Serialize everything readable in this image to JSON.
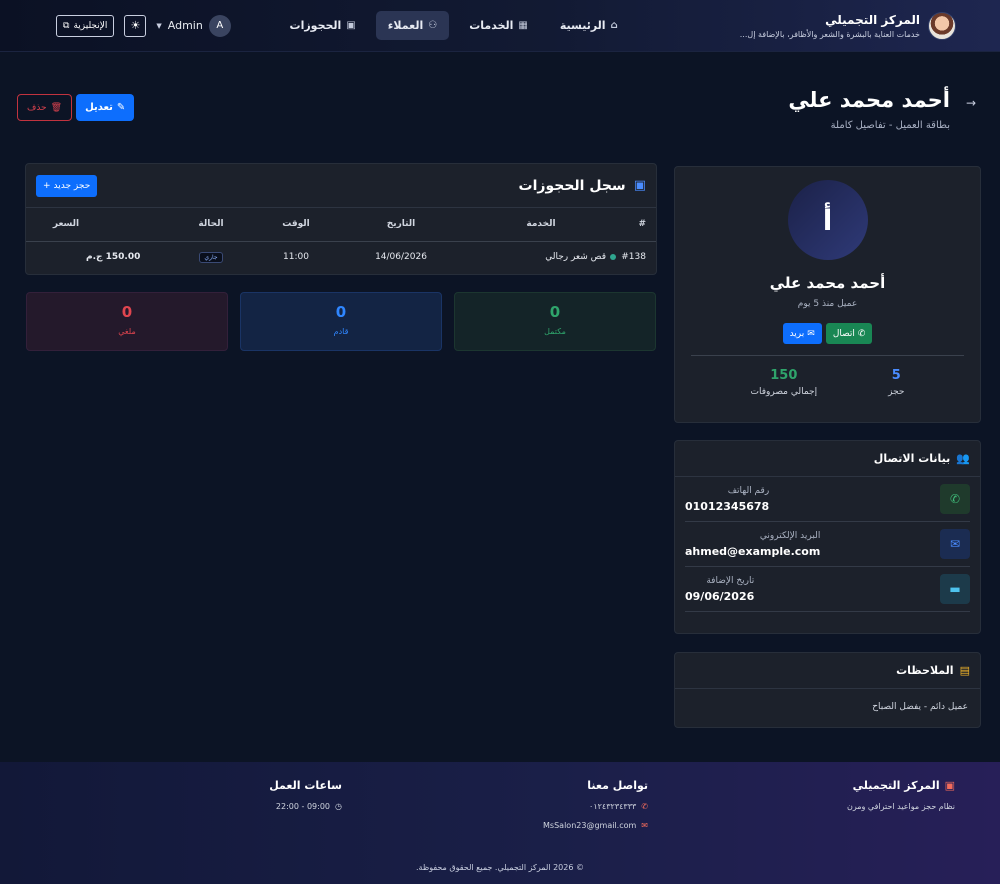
{
  "navbar": {
    "brand_name": "المركز التجميلي",
    "brand_tagline": "خدمات العناية بالبشرة والشعر والأظافر، بالإضافة إل...",
    "links": [
      {
        "label": "الرئيسية",
        "icon": "home-icon"
      },
      {
        "label": "الخدمات",
        "icon": "grid-icon"
      },
      {
        "label": "العملاء",
        "icon": "users-icon"
      },
      {
        "label": "الحجوزات",
        "icon": "calendar-icon"
      }
    ],
    "active_link": "العملاء",
    "user_name": "Admin",
    "user_initial": "A",
    "language_label": "الإنجليزية"
  },
  "header": {
    "title": "أحمد محمد علي",
    "subtitle": "بطاقة العميل - تفاصيل كاملة",
    "edit_label": "تعديل",
    "delete_label": "حذف"
  },
  "profile": {
    "initial": "أ",
    "name": "أحمد محمد علي",
    "since": "عميل منذ 5 يوم",
    "call_label": "اتصال",
    "mail_label": "بريد",
    "stats": [
      {
        "value": "5",
        "label": "حجز",
        "color": "#4a8cff"
      },
      {
        "value": "150",
        "label": "إجمالي مصروفات",
        "color": "#2fa46b"
      }
    ]
  },
  "contact": {
    "title": "بيانات الاتصال",
    "rows": [
      {
        "label": "رقم الهاتف",
        "value": "01012345678",
        "icon": "phone-icon"
      },
      {
        "label": "البريد الإلكتروني",
        "value": "ahmed@example.com",
        "icon": "envelope-icon"
      },
      {
        "label": "تاريخ الإضافة",
        "value": "09/06/2026",
        "icon": "calendar-icon"
      }
    ]
  },
  "notes": {
    "title": "الملاحظات",
    "text": "عميل دائم - يفضل الصباح"
  },
  "bookings": {
    "title": "سجل الحجوزات",
    "new_label": "حجز جديد",
    "columns": [
      "#",
      "الخدمة",
      "التاريخ",
      "الوقت",
      "الحالة",
      "السعر"
    ],
    "rows": [
      {
        "id": "#138",
        "service": "قص شعر رجالي",
        "date": "14/06/2026",
        "time": "11:00",
        "status": "جاري",
        "price": "150.00 ج.م"
      }
    ]
  },
  "summary": {
    "completed": {
      "value": "0",
      "label": "مكتمل"
    },
    "upcoming": {
      "value": "0",
      "label": "قادم"
    },
    "cancelled": {
      "value": "0",
      "label": "ملغي"
    }
  },
  "footer": {
    "brand_name": "المركز التجميلي",
    "brand_tagline": "نظام حجز مواعيد احترافي ومرن",
    "contact_title": "تواصل معنا",
    "phone": "٠١٢٤٣٢٣٤٣٣٣",
    "email": "MsSalon23@gmail.com",
    "hours_title": "ساعات العمل",
    "hours": "09:00 - 22:00",
    "copyright": "© 2026 المركز التجميلي. جميع الحقوق محفوظة."
  },
  "colors": {
    "primary": "#0d6efd",
    "success": "#198754",
    "danger": "#dc3545",
    "background": "#0c1425",
    "card": "#1c212b"
  }
}
